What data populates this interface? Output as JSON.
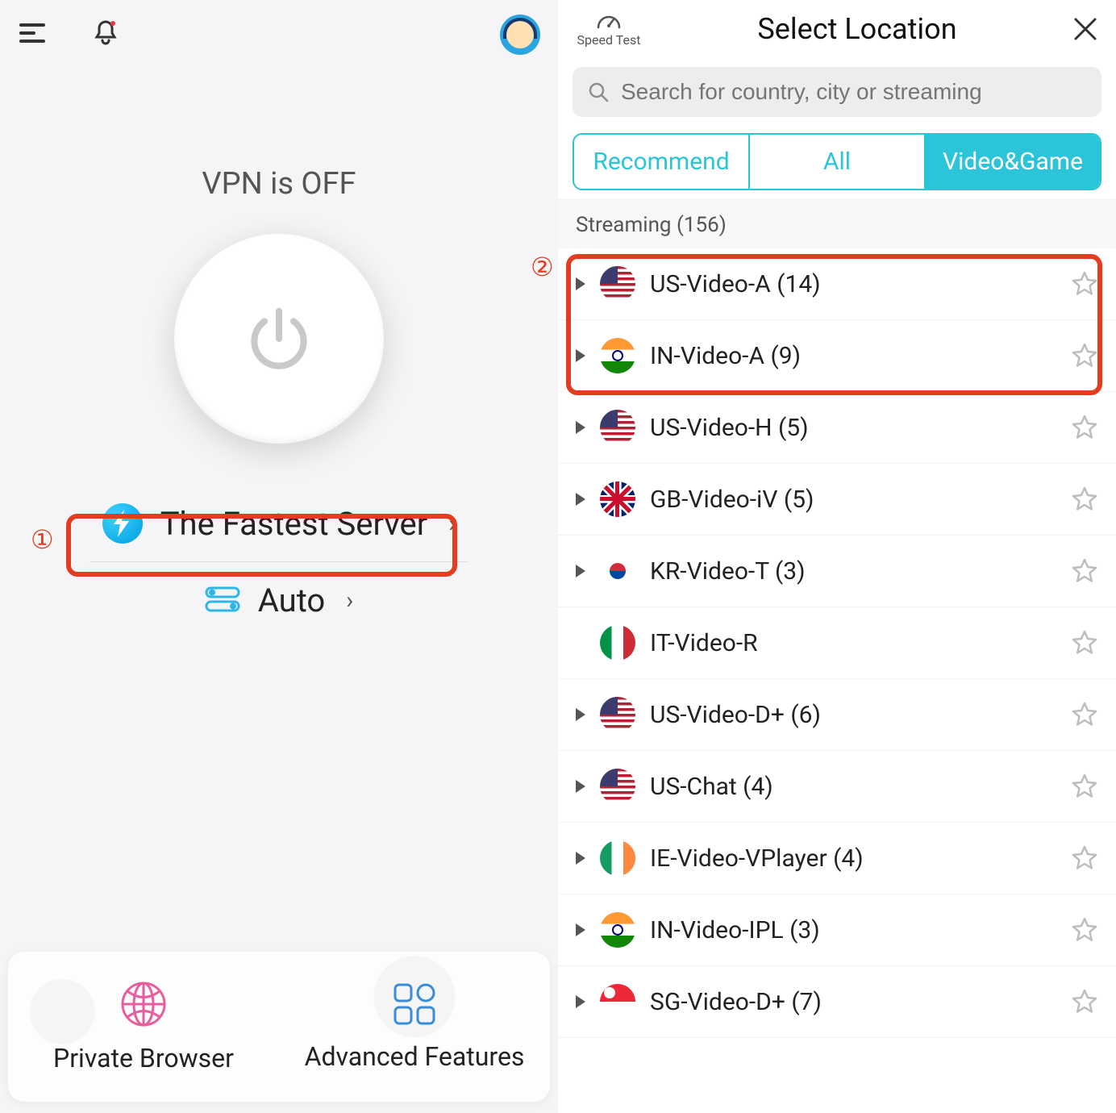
{
  "left": {
    "vpn_status": "VPN is OFF",
    "fastest_server": "The Fastest Server",
    "auto": "Auto",
    "private_browser": "Private Browser",
    "advanced_features": "Advanced Features"
  },
  "right": {
    "speed_test": "Speed Test",
    "title": "Select Location",
    "search_placeholder": "Search for country, city or streaming",
    "tabs": {
      "recommend": "Recommend",
      "all": "All",
      "video_game": "Video&Game"
    },
    "section": "Streaming (156)",
    "servers": [
      {
        "flag": "us",
        "name": "US-Video-A (14)",
        "expandable": true
      },
      {
        "flag": "in",
        "name": "IN-Video-A (9)",
        "expandable": true
      },
      {
        "flag": "us",
        "name": "US-Video-H (5)",
        "expandable": true
      },
      {
        "flag": "gb",
        "name": "GB-Video-iV (5)",
        "expandable": true
      },
      {
        "flag": "kr",
        "name": "KR-Video-T (3)",
        "expandable": true
      },
      {
        "flag": "it",
        "name": "IT-Video-R",
        "expandable": false
      },
      {
        "flag": "us",
        "name": "US-Video-D+ (6)",
        "expandable": true
      },
      {
        "flag": "us",
        "name": "US-Chat (4)",
        "expandable": true
      },
      {
        "flag": "ie",
        "name": "IE-Video-VPlayer (4)",
        "expandable": true
      },
      {
        "flag": "in",
        "name": "IN-Video-IPL (3)",
        "expandable": true
      },
      {
        "flag": "sg",
        "name": "SG-Video-D+ (7)",
        "expandable": true
      }
    ]
  },
  "callouts": {
    "one": "1",
    "two": "2"
  }
}
